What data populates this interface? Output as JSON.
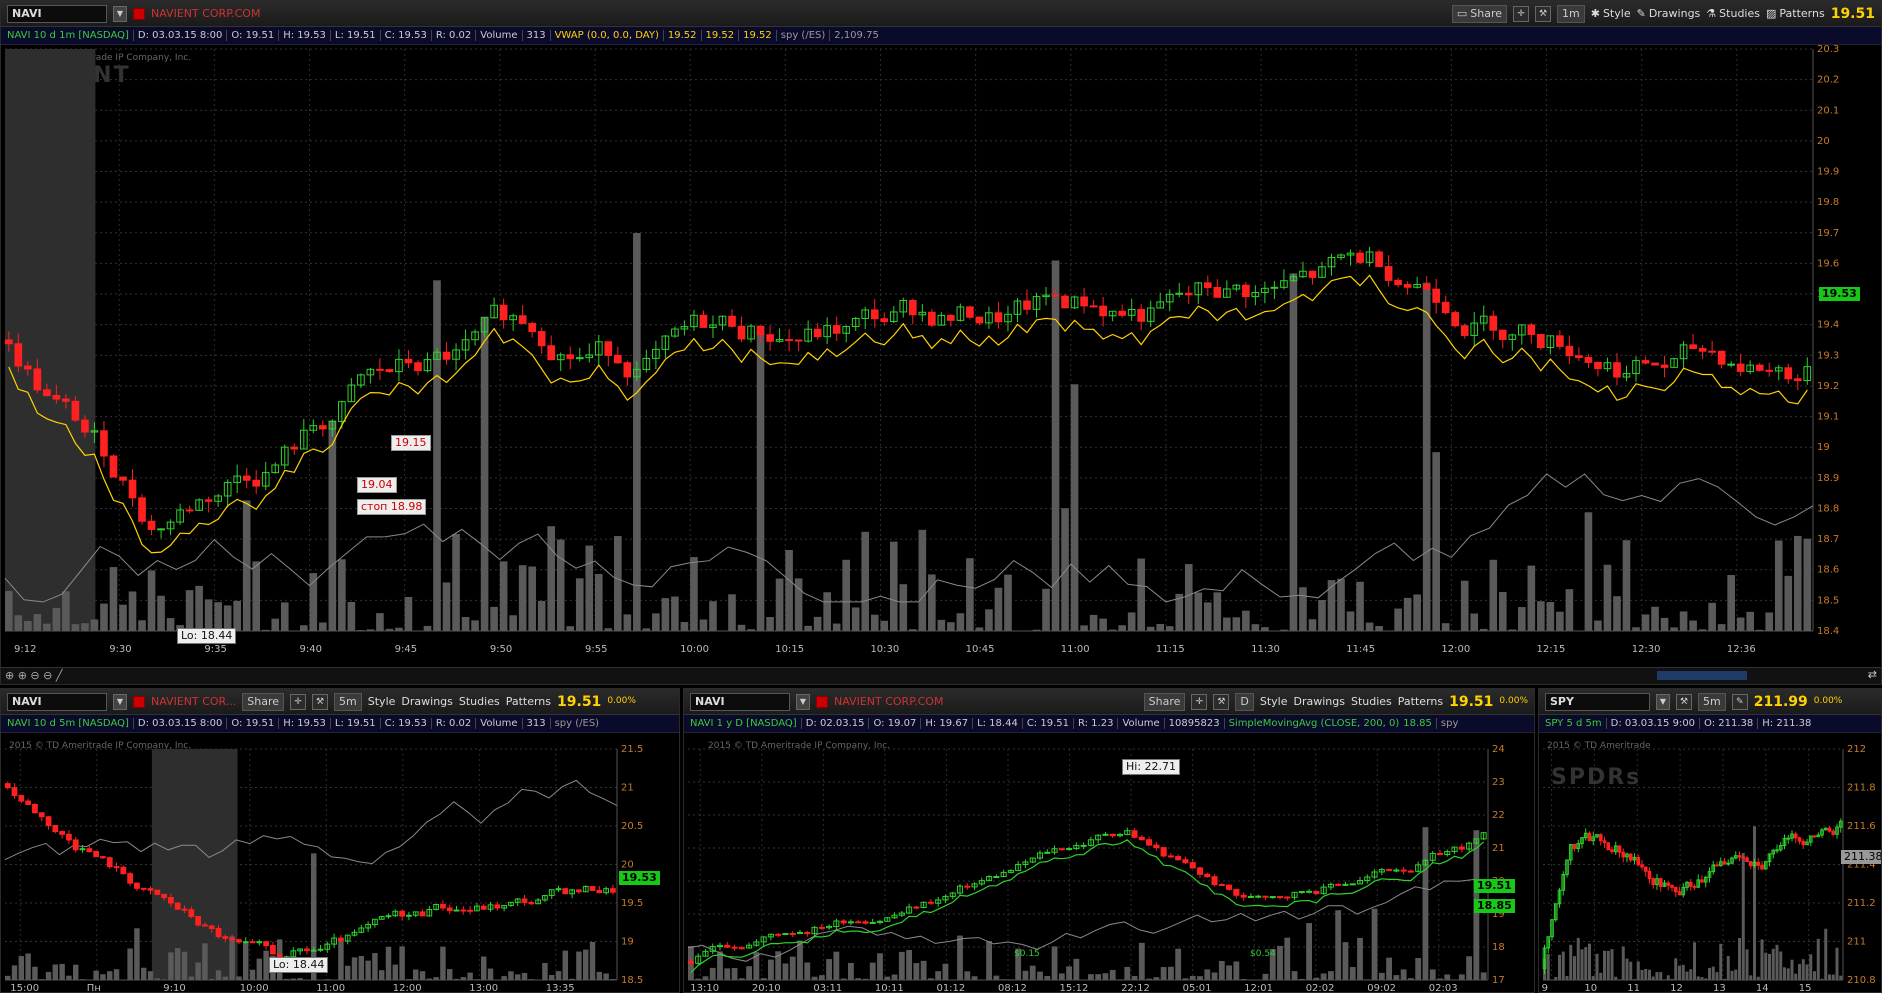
{
  "main": {
    "symbol": "NAVI",
    "corp": "NAVIENT CORP.COM",
    "share": "Share",
    "interval": "1m",
    "style": "Style",
    "drawings": "Drawings",
    "studies": "Studies",
    "patterns": "Patterns",
    "price": "19.51",
    "info": {
      "title": "NAVI 10 d 1m [NASDAQ]",
      "date": "D: 03.03.15 8:00",
      "o": "O: 19.51",
      "h": "H: 19.53",
      "l": "L: 19.51",
      "c": "C: 19.53",
      "r": "R: 0.02",
      "vol_label": "Volume",
      "vol": "313",
      "vwap": "VWAP (0.0, 0.0, DAY)",
      "v1": "19.52",
      "v2": "19.52",
      "v3": "19.52",
      "spy": "spy (/ES)",
      "spyv": "2,109.75"
    },
    "copyright": "2015 © TD Ameritrade IP Company, Inc.",
    "watermark": "NAVIENT",
    "y_ticks": [
      "20.3",
      "20.2",
      "20.1",
      "20",
      "19.9",
      "19.8",
      "19.7",
      "19.6",
      "19.5",
      "19.4",
      "19.3",
      "19.2",
      "19.1",
      "19",
      "18.9",
      "18.8",
      "18.7",
      "18.6",
      "18.5",
      "18.4"
    ],
    "x_ticks": [
      "9:12",
      "9:30",
      "9:35",
      "9:40",
      "9:45",
      "9:50",
      "9:55",
      "10:00",
      "10:15",
      "10:30",
      "10:45",
      "11:00",
      "11:15",
      "11:30",
      "11:45",
      "12:00",
      "12:15",
      "12:30",
      "12:36"
    ],
    "last_label": "19.53",
    "annotations": {
      "lo": "Lo: 18.44",
      "entry": "19.04",
      "stop": "стоп 18.98",
      "exit": "19.15"
    }
  },
  "bl": {
    "symbol": "NAVI",
    "corp": "NAVIENT COR...",
    "share": "Share",
    "interval": "5m",
    "style": "Style",
    "drawings": "Drawings",
    "studies": "Studies",
    "patterns": "Patterns",
    "price": "19.51",
    "pct": "0.00%",
    "info": {
      "title": "NAVI 10 d 5m [NASDAQ]",
      "date": "D: 03.03.15 8:00",
      "o": "O: 19.51",
      "h": "H: 19.53",
      "l": "L: 19.51",
      "c": "C: 19.53",
      "r": "R: 0.02",
      "vol_label": "Volume",
      "vol": "313",
      "spy": "spy (/ES)"
    },
    "copyright": "2015 © TD Ameritrade IP Company, Inc.",
    "y_ticks": [
      "21.5",
      "21",
      "20.5",
      "20",
      "19.5",
      "19",
      "18.5"
    ],
    "x_ticks": [
      "15:00",
      "Пн",
      "9:10",
      "10:00",
      "11:00",
      "12:00",
      "13:00",
      "13:35"
    ],
    "last_label": "19.53",
    "lo": "Lo: 18.44"
  },
  "bm": {
    "symbol": "NAVI",
    "corp": "NAVIENT CORP.COM",
    "share": "Share",
    "interval": "D",
    "style": "Style",
    "drawings": "Drawings",
    "studies": "Studies",
    "patterns": "Patterns",
    "price": "19.51",
    "pct": "0.00%",
    "info": {
      "title": "NAVI 1 y D [NASDAQ]",
      "date": "D: 02.03.15",
      "o": "O: 19.07",
      "h": "H: 19.67",
      "l": "L: 18.44",
      "c": "C: 19.51",
      "r": "R: 1.23",
      "vol_label": "Volume",
      "vol": "10895823",
      "sma": "SimpleMovingAvg (CLOSE, 200, 0)",
      "smav": "18.85",
      "spy": "spy"
    },
    "copyright": "2015 © TD Ameritrade IP Company, Inc.",
    "y_ticks": [
      "24",
      "23",
      "22",
      "21",
      "20",
      "19",
      "18",
      "17"
    ],
    "x_ticks": [
      "13:10",
      "20:10",
      "03:11",
      "10:11",
      "01:12",
      "08:12",
      "15:12",
      "22:12",
      "05:01",
      "12:01",
      "02:02",
      "09:02",
      "02:03"
    ],
    "hi": "Hi: 22.71",
    "last_label": "19.51",
    "sma_label": "18.85",
    "div1": "$0.15",
    "div2": "$0.54"
  },
  "br": {
    "symbol": "SPY",
    "interval": "5m",
    "price": "211.99",
    "pct": "0.00%",
    "info": {
      "title": "SPY 5 d 5m",
      "date": "D: 03.03.15 9:00",
      "o": "O: 211.38",
      "h": "H: 211.38"
    },
    "copyright": "2015 © TD Ameritrade",
    "watermark": "SPDRs",
    "y_ticks": [
      "212",
      "211.8",
      "211.6",
      "211.4",
      "211.2",
      "211",
      "210.8"
    ],
    "x_ticks": [
      "9",
      "10",
      "11",
      "12",
      "13",
      "14",
      "15"
    ],
    "last_label": "211.38"
  },
  "colors": {
    "up": "#2fd12f",
    "down": "#ff2020",
    "vwap": "#ffd200",
    "spy": "#8a8a8a",
    "vol": "#5a5a5a",
    "axis": "#c77a2a"
  }
}
